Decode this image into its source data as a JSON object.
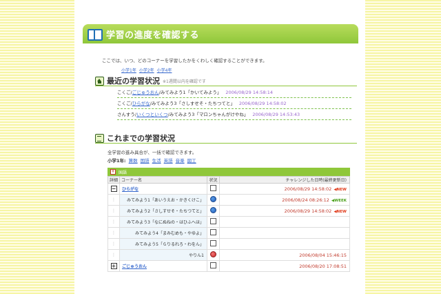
{
  "header": {
    "title": "学習の進度を確認する"
  },
  "intro": "ここでは、いつ、どのコーナーを学習したかをくわしく確認することができます。",
  "grade_links": [
    "小学1年",
    "小学2年",
    "小学4年"
  ],
  "recent": {
    "title": "最近の学習状況",
    "note": "※1週間以内を確認です",
    "rows": [
      {
        "prefix": "こくご/",
        "link": "ごじゅうおん",
        "text": "/みてみよう1「かいてみよう」",
        "date": "2006/08/29 14:58:14"
      },
      {
        "prefix": "こくご/",
        "link": "ひらがな",
        "text": "/みてみよう3「さしすせそ・たちつてと」",
        "date": "2006/08/29 14:58:02"
      },
      {
        "prefix": "さんすう/",
        "link": "いくつといくつ",
        "text": "/みてみよう3「マロンちゃんがけやね」",
        "date": "2006/08/29 14:53:43"
      }
    ]
  },
  "overall": {
    "title": "これまでの学習状況",
    "desc": "全学習の進み具合が、一括で確認できます。",
    "grade_label": "小学1年:",
    "subjects": [
      "算数",
      "国語",
      "生活",
      "英語",
      "音楽",
      "図工"
    ]
  },
  "table": {
    "top_label": "国語",
    "headers": [
      "詳細",
      "コーナー名",
      "状況",
      "チャレンジした日時(最終更新日)"
    ],
    "rows": [
      {
        "toggle": "−",
        "name": "ひらがな",
        "level": "top",
        "status": "check",
        "date": "2006/08/29 14:58:02",
        "badge": "◀NEW",
        "badge_type": "new"
      },
      {
        "toggle": "⋮",
        "name": "みてみよう1「あいうえお・かきくけこ」",
        "level": "sub",
        "status": "dot",
        "date": "2006/08/24 08:26:12",
        "badge": "◀WEEK",
        "badge_type": "week"
      },
      {
        "toggle": "⋮",
        "name": "みてみよう2「さしすせそ・たちつてと」",
        "level": "sub",
        "status": "dot",
        "date": "2006/08/29 14:58:02",
        "badge": "◀NEW",
        "badge_type": "new"
      },
      {
        "toggle": "⋮",
        "name": "みてみよう3「なにぬねの・はひふへほ」",
        "level": "sub",
        "status": "check",
        "date": "",
        "badge": "",
        "badge_type": ""
      },
      {
        "toggle": "⋮",
        "name": "みてみよう4「まみむめも・やゆよ」",
        "level": "sub",
        "status": "check",
        "date": "",
        "badge": "",
        "badge_type": ""
      },
      {
        "toggle": "⋮",
        "name": "みてみよう5「らりるれろ・わをん」",
        "level": "sub",
        "status": "check",
        "date": "",
        "badge": "",
        "badge_type": ""
      },
      {
        "toggle": "⋮",
        "name": "やりん1",
        "level": "sub",
        "status": "dot-red",
        "date": "2006/08/04 15:46:15",
        "badge": "",
        "badge_type": ""
      },
      {
        "toggle": "+",
        "name": "ごじゅうおん",
        "level": "top",
        "status": "check",
        "date": "2006/08/20 17:08:51",
        "badge": "",
        "badge_type": ""
      }
    ]
  }
}
